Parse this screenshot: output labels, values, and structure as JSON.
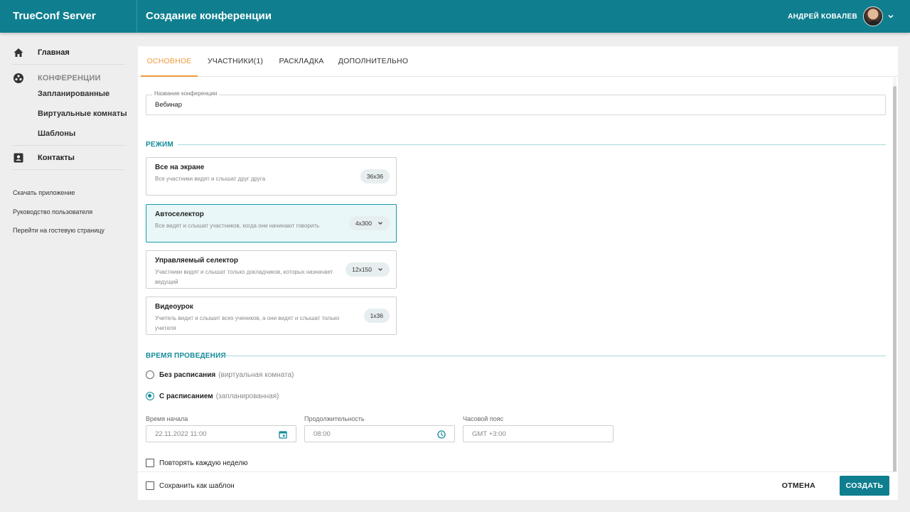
{
  "app": {
    "brand": "TrueConf Server",
    "page_title": "Создание конференции"
  },
  "user": {
    "name": "АНДРЕЙ КОВАЛЕВ"
  },
  "sidebar": {
    "home": "Главная",
    "conferences": "КОНФЕРЕНЦИИ",
    "scheduled": "Запланированные",
    "virtual_rooms": "Виртуальные комнаты",
    "templates": "Шаблоны",
    "contacts": "Контакты",
    "links": [
      "Скачать приложение",
      "Руководство пользователя",
      "Перейти на гостевую страницу"
    ]
  },
  "tabs": [
    "ОСНОВНОЕ",
    "УЧАСТНИКИ(1)",
    "РАСКЛАДКА",
    "ДОПОЛНИТЕЛЬНО"
  ],
  "active_tab": "ОСНОВНОЕ",
  "name_field": {
    "label": "Название конференции",
    "value": "Вебинар"
  },
  "mode": {
    "title": "РЕЖИМ",
    "options": [
      {
        "title": "Все на экране",
        "desc": "Все участники видят и слышат друг друга",
        "value": "36x36",
        "selected": false
      },
      {
        "title": "Автоселектор",
        "desc": "Все видят и слышат участников, когда они начинают говорить",
        "value": "4x300",
        "selected": true
      },
      {
        "title": "Управляемый селектор",
        "desc": "Участники видят и слышат только докладчиков, которых назначает ведущий",
        "value": "12x150",
        "selected": false
      },
      {
        "title": "Видеоурок",
        "desc": "Учитель видит и слышит всех учеников, а они видят и слышат только учителя",
        "value": "1x36",
        "selected": false
      }
    ]
  },
  "schedule": {
    "title": "ВРЕМЯ ПРОВЕДЕНИЯ",
    "no_schedule": {
      "label": "Без расписания",
      "hint": "(виртуальная комната)",
      "checked": false
    },
    "with_schedule": {
      "label": "С расписанием",
      "hint": "(запланированная)",
      "checked": true
    },
    "start_label": "Время начала",
    "start_value": "22.11.2022 11:00",
    "duration_label": "Продолжительность",
    "duration_value": "08:00",
    "timezone_label": "Часовой пояс",
    "timezone_value": "GMT +3:00",
    "repeat_weekly": "Повторять каждую неделю"
  },
  "footer": {
    "save_template": "Сохранить как шаблон",
    "cancel": "ОТМЕНА",
    "create": "СОЗДАТЬ"
  },
  "colors": {
    "primary": "#0f7f8f",
    "accent": "#ef9a3c",
    "section": "#138b99"
  }
}
